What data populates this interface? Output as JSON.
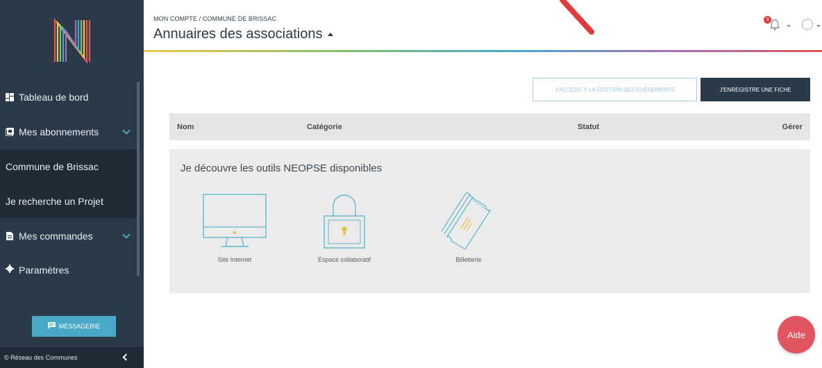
{
  "sidebar": {
    "items": [
      {
        "label": "Tableau de bord",
        "icon": "dashboard-icon"
      },
      {
        "label": "Mes abonnements",
        "icon": "subscriptions-icon"
      },
      {
        "label": "Commune de Brissac"
      },
      {
        "label": "Je recherche un Projet"
      },
      {
        "label": "Mes commandes",
        "icon": "document-icon"
      },
      {
        "label": "Paramètres",
        "icon": "gear-icon"
      }
    ],
    "message_button": "MESSAGERIE",
    "footer": "© Réseau des Communes"
  },
  "header": {
    "breadcrumb": "MON COMPTE / COMMUNE DE BRISSAC",
    "title": "Annuaires des associations",
    "notification_count": "3"
  },
  "actions": {
    "events_button": "J'ACCÈDE À LA GESTION DES ÉVÉNEMENTS",
    "register_button": "J'ENREGISTRE UNE FICHE"
  },
  "table": {
    "columns": [
      "Nom",
      "Catégorie",
      "Statut",
      "Gérer"
    ]
  },
  "tools": {
    "title": "Je découvre les outils NEOPSE disponibles",
    "items": [
      {
        "label": "Site Internet",
        "icon": "monitor-icon"
      },
      {
        "label": "Espace collaboratif",
        "icon": "padlock-icon"
      },
      {
        "label": "Billetterie",
        "icon": "tickets-icon"
      }
    ]
  },
  "aide_button": "Aide",
  "colors": {
    "sidebar": "#2b3a48",
    "accent": "#4aa8c6",
    "aide": "#e15561",
    "badge": "#e23b3b"
  }
}
